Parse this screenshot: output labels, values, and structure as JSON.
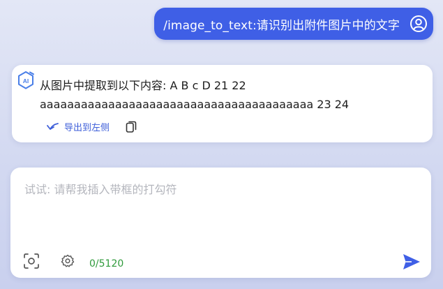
{
  "user_message": {
    "text": "/image_to_text:请识别出附件图片中的文字",
    "avatar_icon": "user-circle-icon"
  },
  "ai_response": {
    "logo_icon": "ai-hexagon-logo-icon",
    "logo_text": "AI",
    "text": "从图片中提取到以下内容: A B c D 21 22\naaaaaaaaaaaaaaaaaaaaaaaaaaaaaaaaaaaaaaaa 23 24",
    "actions": {
      "export_label": "导出到左侧",
      "export_icon": "export-arrow-icon",
      "copy_icon": "copy-icon"
    }
  },
  "input_panel": {
    "placeholder": "试试: 请帮我插入带框的打勾符",
    "value": "",
    "char_count": "0/5120",
    "screenshot_icon": "screenshot-icon",
    "settings_icon": "gear-icon",
    "send_icon": "send-icon"
  },
  "colors": {
    "accent": "#3f5fe6",
    "link": "#3d5ed9",
    "counter": "#2f9a3b"
  }
}
